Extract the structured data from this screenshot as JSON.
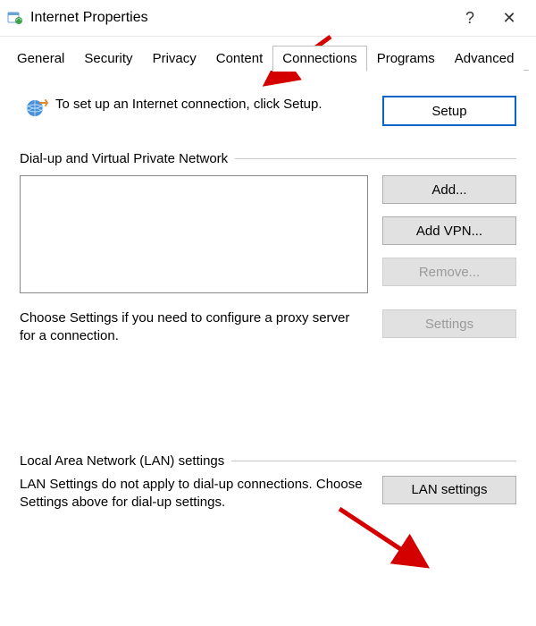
{
  "window": {
    "title": "Internet Properties",
    "help": "?",
    "close": "✕"
  },
  "tabs": {
    "general": "General",
    "security": "Security",
    "privacy": "Privacy",
    "content": "Content",
    "connections": "Connections",
    "programs": "Programs",
    "advanced": "Advanced"
  },
  "setup": {
    "text": "To set up an Internet connection, click Setup.",
    "button": "Setup"
  },
  "dialup": {
    "heading": "Dial-up and Virtual Private Network",
    "add": "Add...",
    "add_vpn": "Add VPN...",
    "remove": "Remove...",
    "proxy_text": "Choose Settings if you need to configure a proxy server for a connection.",
    "settings": "Settings"
  },
  "lan": {
    "heading": "Local Area Network (LAN) settings",
    "text": "LAN Settings do not apply to dial-up connections. Choose Settings above for dial-up settings.",
    "button": "LAN settings"
  }
}
